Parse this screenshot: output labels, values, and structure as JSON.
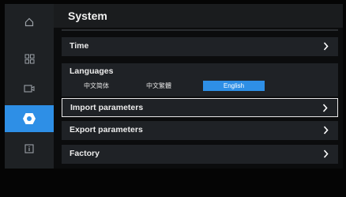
{
  "page_title": "System",
  "sidebar": {
    "items": [
      {
        "icon": "home-icon"
      },
      {
        "icon": "grid-icon"
      },
      {
        "icon": "camera-icon"
      },
      {
        "icon": "settings-hex-icon",
        "active": true
      },
      {
        "icon": "info-icon"
      }
    ]
  },
  "menu": {
    "time_label": "Time",
    "languages": {
      "title": "Languages",
      "options": [
        "中文简体",
        "中文繁體",
        "English"
      ],
      "selected": "English"
    },
    "import_label": "Import parameters",
    "export_label": "Export parameters",
    "factory_label": "Factory"
  },
  "colors": {
    "accent": "#2e8fe6",
    "background": "#0b0c0d",
    "row": "#1f2226",
    "sidebar": "#1e2124"
  }
}
